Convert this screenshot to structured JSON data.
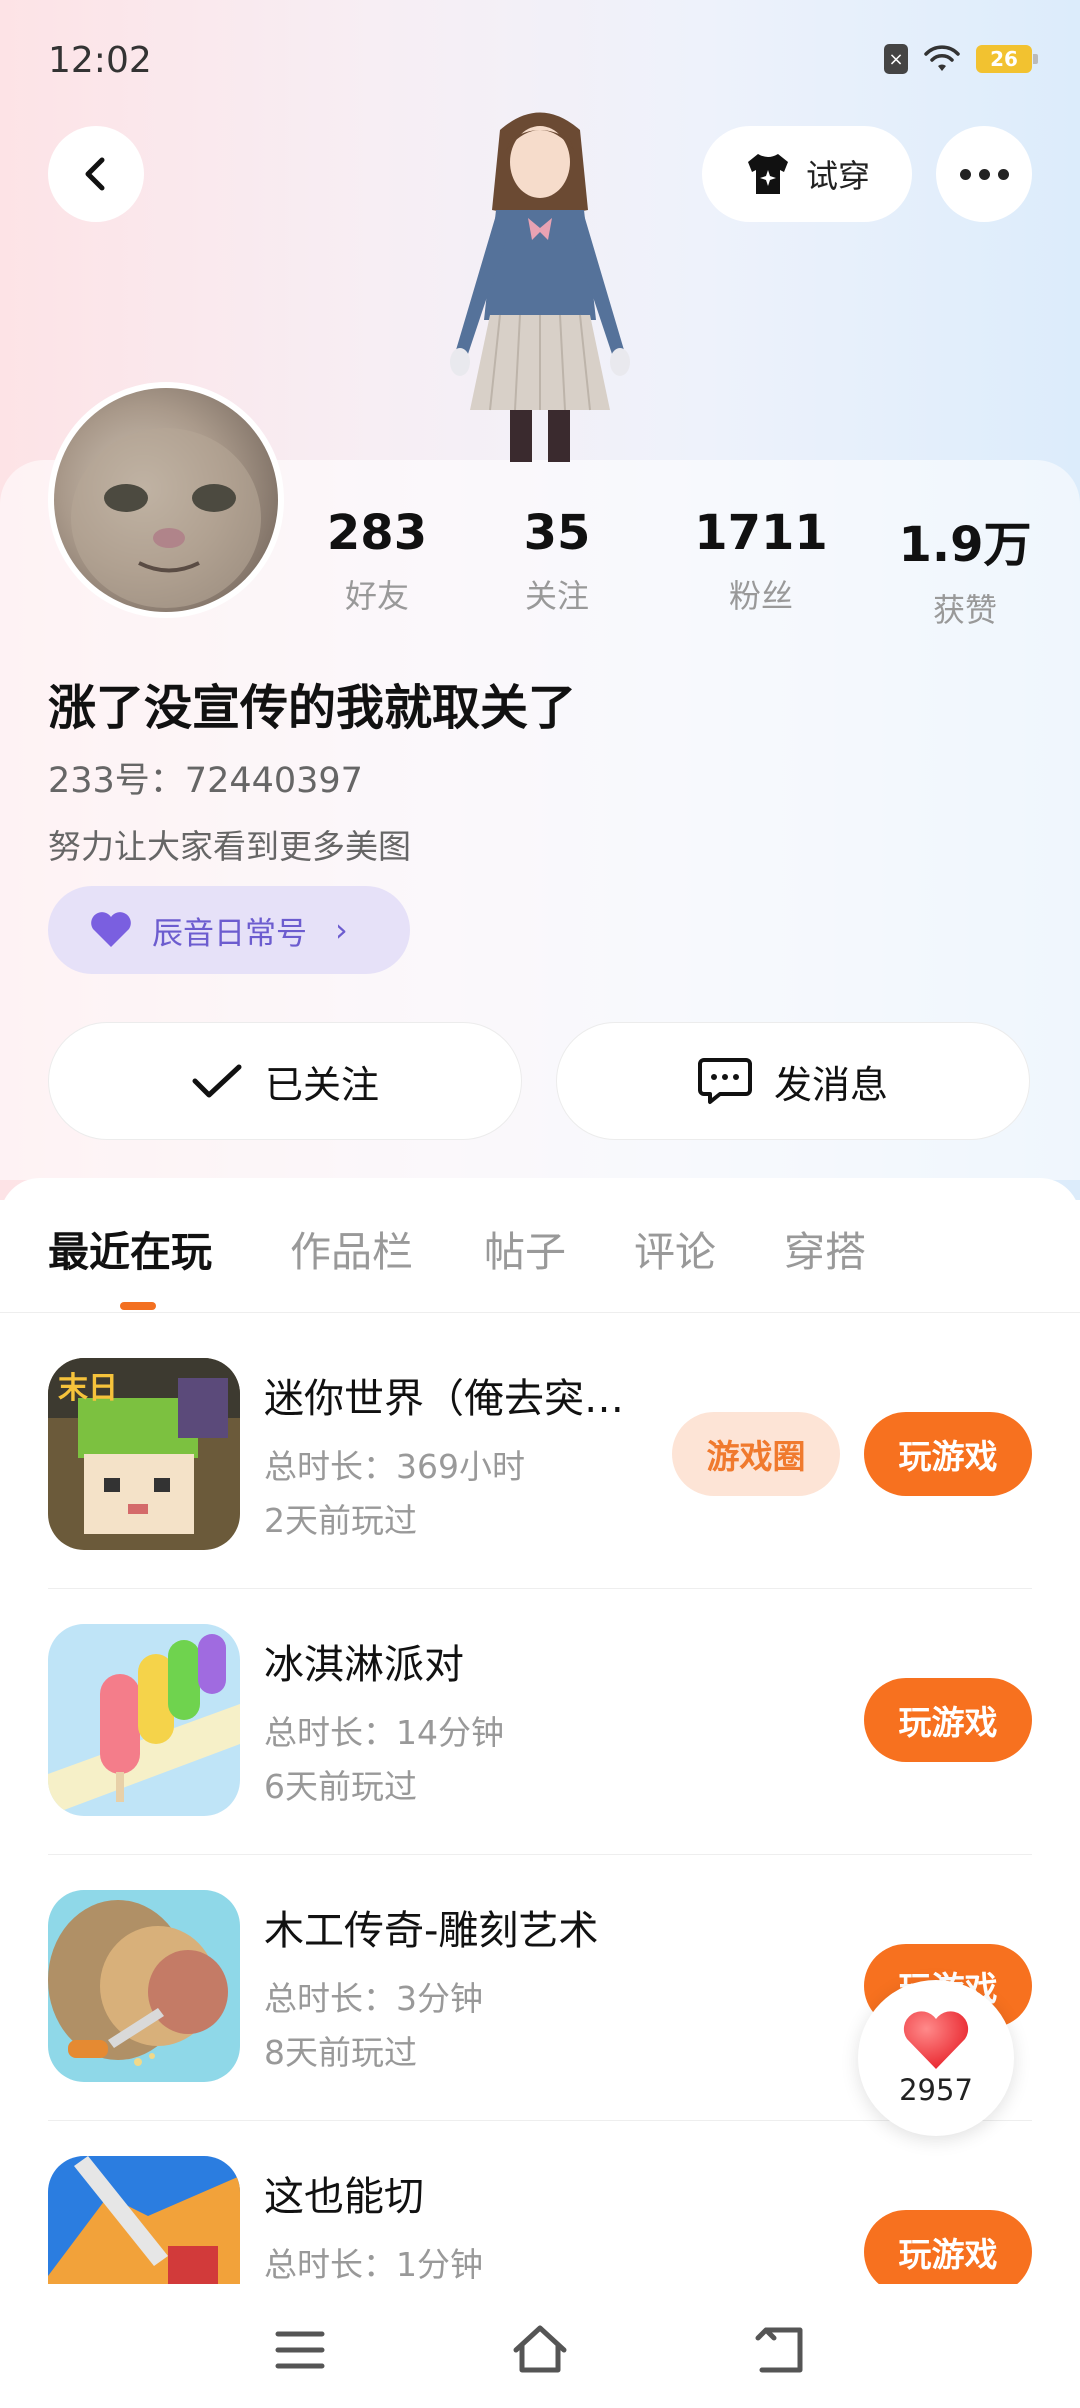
{
  "status_bar": {
    "time": "12:02",
    "battery": "26"
  },
  "top_actions": {
    "try_on_label": "试穿"
  },
  "stats": [
    {
      "value": "283",
      "label": "好友"
    },
    {
      "value": "35",
      "label": "关注"
    },
    {
      "value": "1711",
      "label": "粉丝"
    },
    {
      "value": "1.9万",
      "label": "获赞"
    }
  ],
  "profile": {
    "name": "涨了没宣传的我就取关了",
    "uid": "233号：72440397",
    "bio": "努力让大家看到更多美图",
    "circle_tag": "辰音日常号"
  },
  "actions": {
    "follow_label": "已关注",
    "message_label": "发消息"
  },
  "tabs": [
    {
      "label": "最近在玩"
    },
    {
      "label": "作品栏"
    },
    {
      "label": "帖子"
    },
    {
      "label": "评论"
    },
    {
      "label": "穿搭"
    }
  ],
  "games": [
    {
      "title": "迷你世界（俺去突…",
      "duration": "总时长：369小时",
      "last_played": "2天前玩过",
      "circle_label": "游戏圈",
      "play_label": "玩游戏"
    },
    {
      "title": "冰淇淋派对",
      "duration": "总时长：14分钟",
      "last_played": "6天前玩过",
      "play_label": "玩游戏"
    },
    {
      "title": "木工传奇-雕刻艺术",
      "duration": "总时长：3分钟",
      "last_played": "8天前玩过",
      "play_label": "玩游戏"
    },
    {
      "title": "这也能切",
      "duration": "总时长：1分钟",
      "play_label": "玩游戏"
    }
  ],
  "like_badge": {
    "count": "2957"
  },
  "colors": {
    "accent": "#f7711f",
    "tag_purple": "#6c5ccf"
  }
}
